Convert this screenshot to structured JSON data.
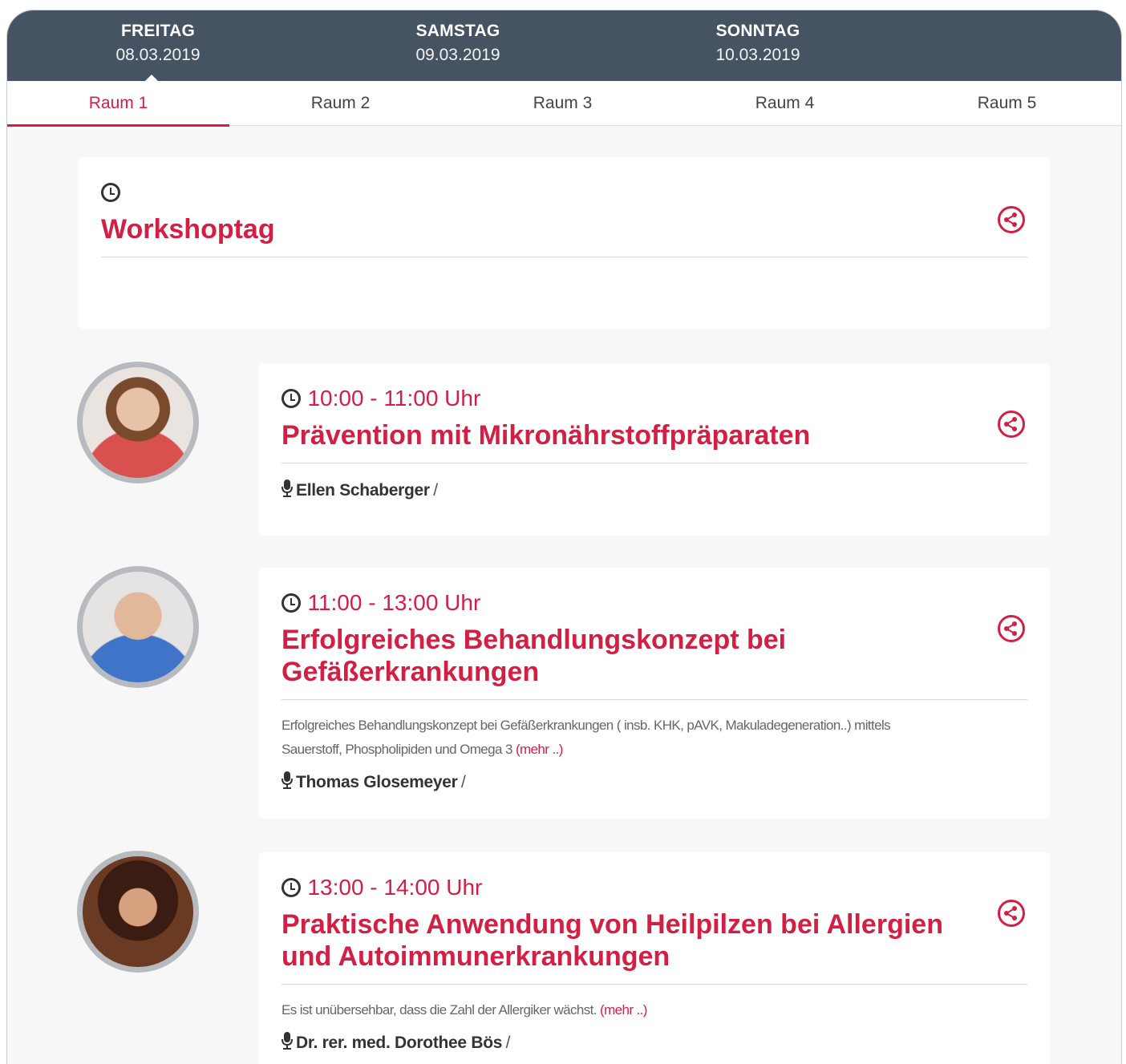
{
  "days": [
    {
      "name": "FREITAG",
      "date": "08.03.2019"
    },
    {
      "name": "SAMSTAG",
      "date": "09.03.2019"
    },
    {
      "name": "SONNTAG",
      "date": "10.03.2019"
    }
  ],
  "rooms": [
    "Raum 1",
    "Raum 2",
    "Raum 3",
    "Raum 4",
    "Raum 5"
  ],
  "header_card": {
    "title": "Workshoptag"
  },
  "sessions": [
    {
      "time": "10:00 - 11:00 Uhr",
      "title_line1": "Prävention mit Mikronährstoffpräparaten",
      "speaker": "Ellen Schaberger",
      "sep": "/"
    },
    {
      "time": "11:00 - 13:00 Uhr",
      "title_line1": "Erfolgreiches Behandlungskonzept bei",
      "title_line2": "Gefäßerkrankungen",
      "desc_line1": "Erfolgreiches Behandlungskonzept bei Gefäßerkrankungen ( insb. KHK, pAVK, Makuladegeneration..) mittels",
      "desc_line2": "Sauerstoff, Phospholipiden und Omega 3",
      "more": "(mehr ..)",
      "speaker": "Thomas Glosemeyer",
      "sep": "/"
    },
    {
      "time": "13:00 - 14:00 Uhr",
      "title_line1": "Praktische Anwendung von Heilpilzen bei Allergien",
      "title_line2": "und Autoimmunerkrankungen",
      "desc_line1": "Es ist unübersehbar, dass die Zahl der Allergiker wächst.",
      "more": "(mehr ..)",
      "speaker": "Dr. rer. med. Dorothee Bös",
      "sep": "/"
    }
  ],
  "colors": {
    "accent": "#d31f43",
    "day_bar": "#465362"
  },
  "icons": [
    "clock-icon",
    "share-icon",
    "microphone-icon"
  ]
}
